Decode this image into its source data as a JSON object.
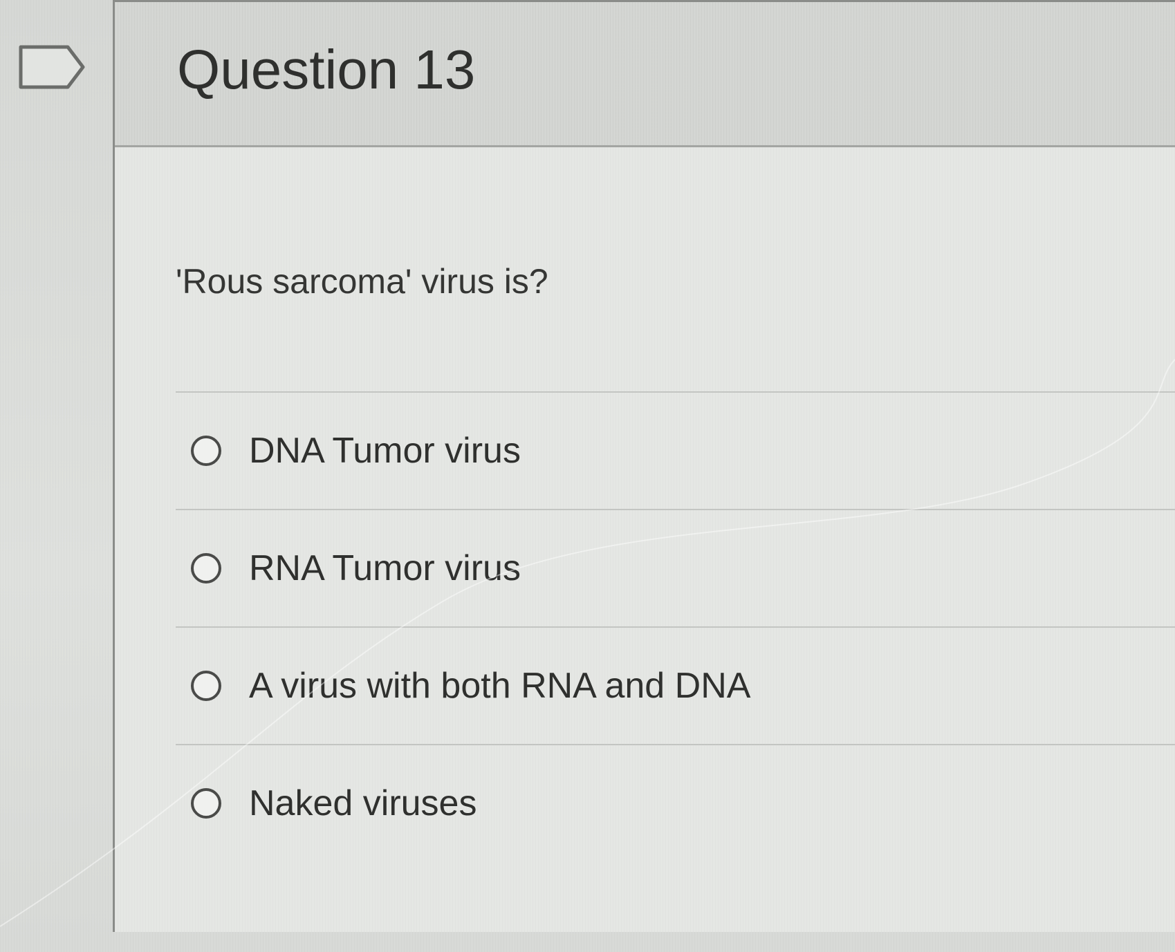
{
  "question": {
    "title": "Question 13",
    "text": "'Rous sarcoma' virus is?",
    "flag_icon": "flag-outline-icon",
    "answers": [
      {
        "label": "DNA Tumor virus",
        "selected": false
      },
      {
        "label": "RNA Tumor virus",
        "selected": false
      },
      {
        "label": "A virus with both RNA and DNA",
        "selected": false
      },
      {
        "label": "Naked viruses",
        "selected": false
      }
    ]
  },
  "colors": {
    "header_bg": "#d4d6d3",
    "body_bg": "#e5e7e4",
    "text": "#2f302e",
    "border": "#8a8c89"
  }
}
